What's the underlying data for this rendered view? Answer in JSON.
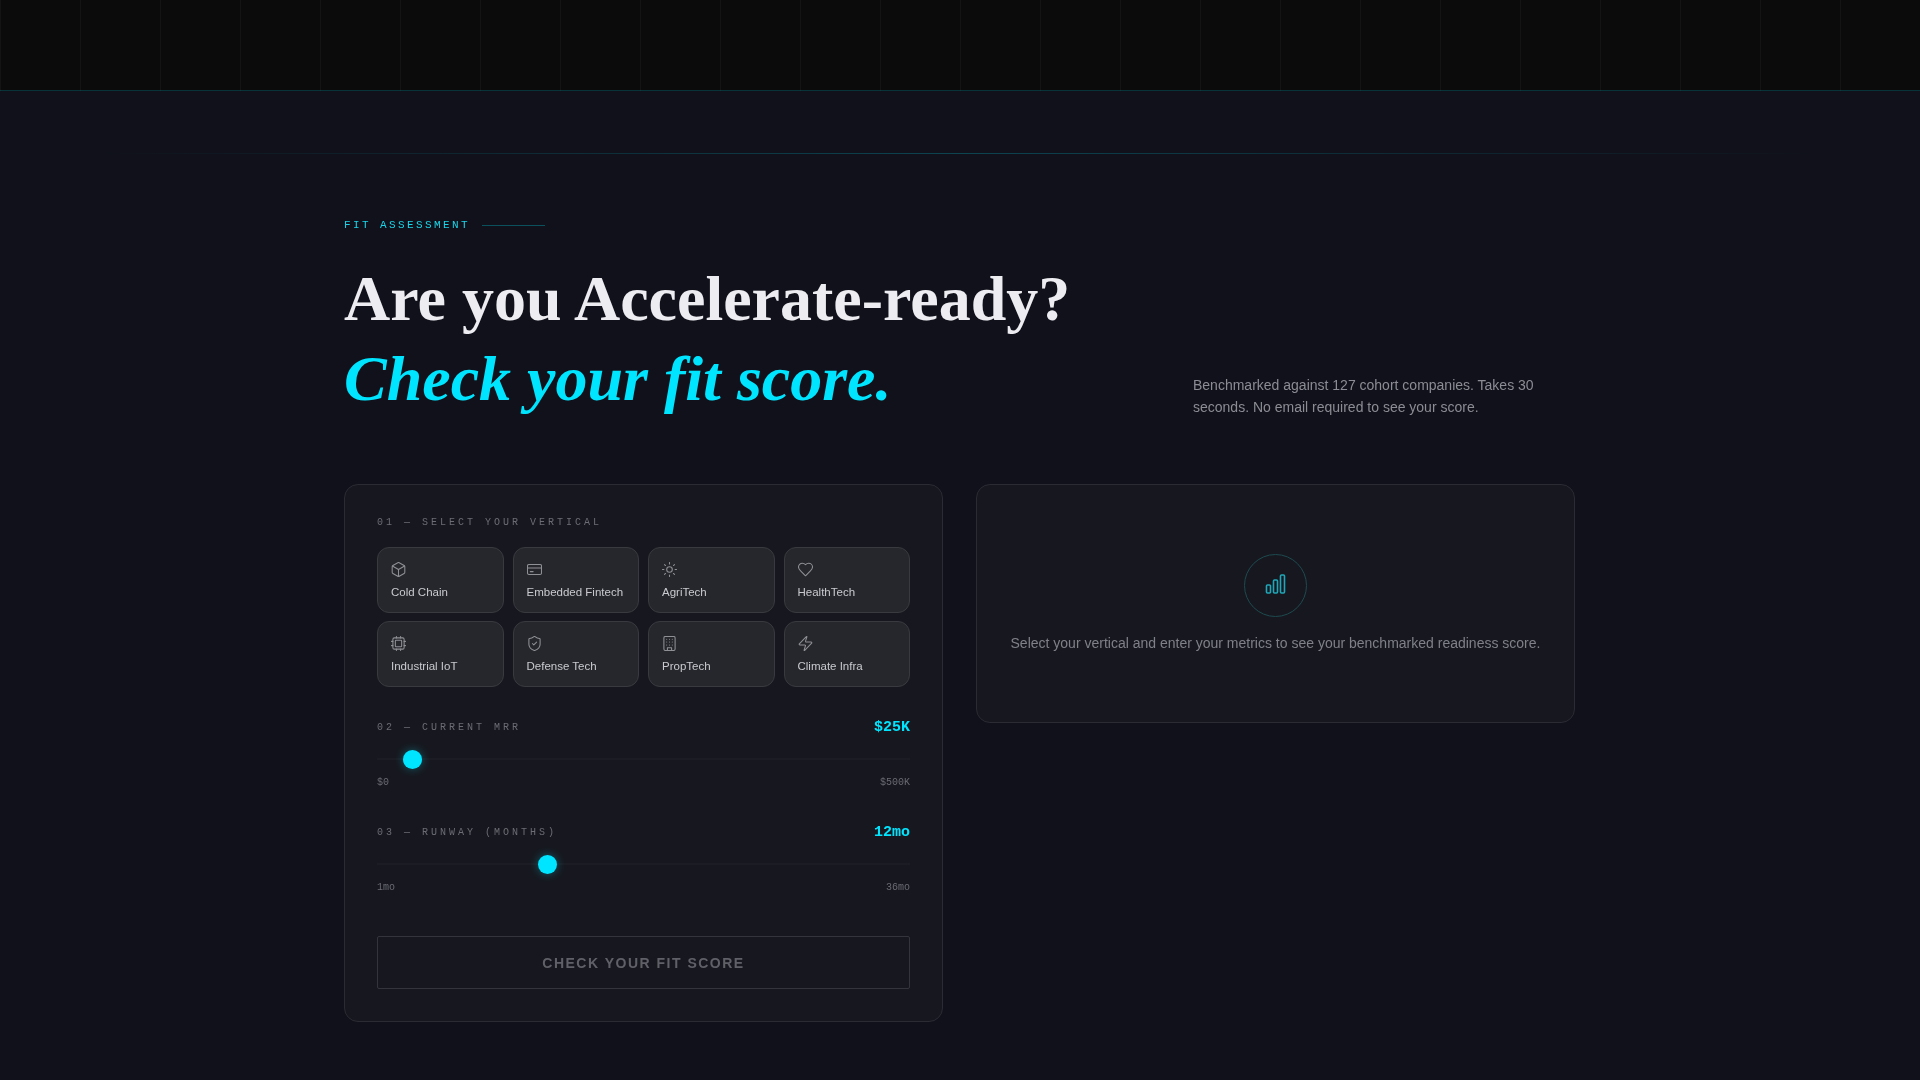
{
  "section": {
    "eyebrow": "FIT ASSESSMENT",
    "title": "Are you Accelerate-ready?",
    "title_accent": "Check your fit score.",
    "description": "Benchmarked against 127 cohort companies. Takes 30 seconds. No email required to see your score."
  },
  "form": {
    "vertical": {
      "label": "01 — SELECT YOUR VERTICAL",
      "options": [
        {
          "label": "Cold Chain",
          "selected": false
        },
        {
          "label": "Embedded Fintech",
          "selected": false
        },
        {
          "label": "AgriTech",
          "selected": false
        },
        {
          "label": "HealthTech",
          "selected": false
        },
        {
          "label": "Industrial IoT",
          "selected": false
        },
        {
          "label": "Defense Tech",
          "selected": false
        },
        {
          "label": "PropTech",
          "selected": false
        },
        {
          "label": "Climate Infra",
          "selected": false
        }
      ]
    },
    "sliders": [
      {
        "label": "02 — CURRENT MRR",
        "value": "$25K",
        "level": 0.05,
        "min": "$0",
        "max": "$500K"
      },
      {
        "label": "03 — RUNWAY (MONTHS)",
        "value": "12mo",
        "level": 0.314,
        "min": "1mo",
        "max": "36mo"
      }
    ],
    "submit": {
      "label": "CHECK YOUR FIT SCORE",
      "disabled": true
    }
  },
  "result": {
    "message": "Select your vertical and enter your metrics to see your benchmarked readiness score."
  }
}
